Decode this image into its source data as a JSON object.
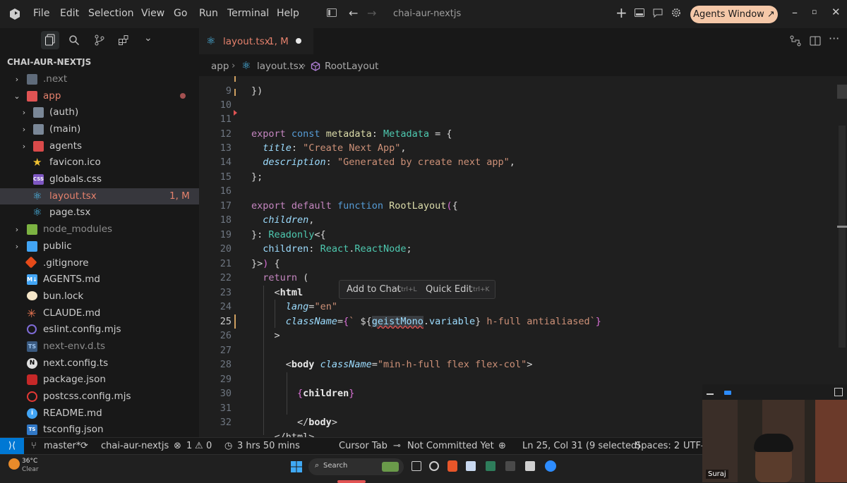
{
  "titlebar": {
    "menu": [
      "File",
      "Edit",
      "Selection",
      "View",
      "Go",
      "Run",
      "Terminal",
      "Help"
    ],
    "project": "chai-aur-nextjs",
    "agents_button": "Agents Window ↗"
  },
  "tab": {
    "label": "layout.tsx",
    "status": "1, M"
  },
  "breadcrumb": [
    "app",
    "layout.tsx",
    "RootLayout"
  ],
  "sidebar": {
    "title": "CHAI-AUR-NEXTJS",
    "items": [
      {
        "label": ".next"
      },
      {
        "label": "app"
      },
      {
        "label": "(auth)"
      },
      {
        "label": "(main)"
      },
      {
        "label": "agents"
      },
      {
        "label": "favicon.ico"
      },
      {
        "label": "globals.css"
      },
      {
        "label": "layout.tsx",
        "badge": "1, M"
      },
      {
        "label": "page.tsx"
      },
      {
        "label": "node_modules"
      },
      {
        "label": "public"
      },
      {
        "label": ".gitignore"
      },
      {
        "label": "AGENTS.md"
      },
      {
        "label": "bun.lock"
      },
      {
        "label": "CLAUDE.md"
      },
      {
        "label": "eslint.config.mjs"
      },
      {
        "label": "next-env.d.ts"
      },
      {
        "label": "next.config.ts"
      },
      {
        "label": "package.json"
      },
      {
        "label": "postcss.config.mjs"
      },
      {
        "label": "README.md"
      },
      {
        "label": "tsconfig.json"
      }
    ]
  },
  "editor": {
    "line_numbers": [
      "9",
      "10",
      "11",
      "12",
      "13",
      "14",
      "15",
      "16",
      "17",
      "18",
      "19",
      "20",
      "21",
      "22",
      "23",
      "24",
      "25",
      "26",
      "27",
      "28",
      "29",
      "30",
      "31",
      "32"
    ],
    "current_line": "25",
    "code": {
      "l9": "})",
      "l12_a": "export",
      "l12_b": "const",
      "l12_c": "metadata",
      "l12_d": "Metadata",
      "l13_prop": "title",
      "l13_val": "\"Create Next App\"",
      "l14_prop": "description",
      "l14_val": "\"Generated by create next app\"",
      "l15": "};",
      "l17_a": "export",
      "l17_b": "default",
      "l17_c": "function",
      "l17_d": "RootLayout",
      "l18": "children",
      "l19_a": "Readonly",
      "l20_a": "children",
      "l20_b": "React",
      "l20_c": "ReactNode",
      "l22": "return",
      "l23": "html",
      "l24_attr": "lang",
      "l24_val": "\"en\"",
      "l25_attr": "className",
      "l25_var": "geistMono",
      "l25_prop": "variable",
      "l25_rest": " h-full antialiased",
      "l28_tag": "body",
      "l28_attr": "className",
      "l28_val": "\"min-h-full flex flex-col\"",
      "l30": "children",
      "l32": "body"
    },
    "hover": {
      "add_label": "Add to Chat",
      "add_key": "Ctrl+L",
      "edit_label": "Quick Edit",
      "edit_key": "Ctrl+K"
    }
  },
  "statusbar": {
    "branch": "master*",
    "project": "chai-aur-nextjs",
    "errors": "1",
    "warnings": "0",
    "time": "3 hrs 50 mins",
    "cursor_tab": "Cursor Tab",
    "commit": "Not Committed Yet",
    "position": "Ln 25, Col 31 (9 selected)",
    "spaces": "Spaces: 2",
    "encoding": "UTF-"
  },
  "taskbar": {
    "weather_temp": "36°C",
    "weather_desc": "Clear",
    "search": "Search"
  },
  "webcam": {
    "name": "Suraj"
  }
}
